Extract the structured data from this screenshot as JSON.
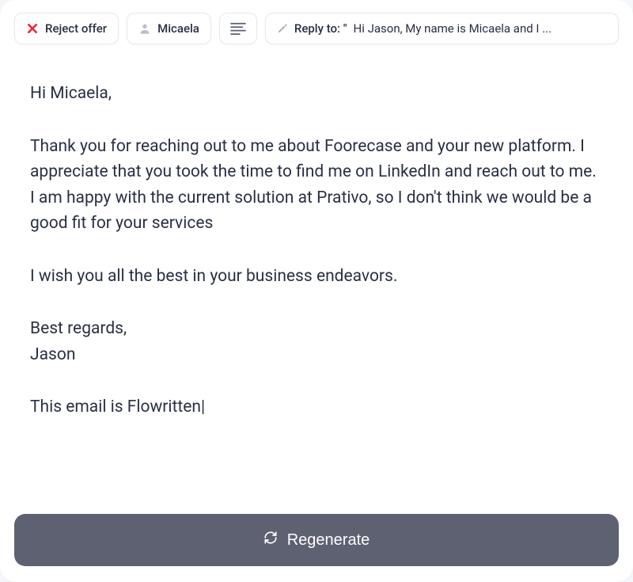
{
  "toolbar": {
    "reject_label": "Reject offer",
    "person_label": "Micaela",
    "reply_prefix": "Reply to: \"",
    "reply_snippet": "Hi Jason, My name is Micaela and I ..."
  },
  "email": {
    "greeting": "Hi Micaela,",
    "para1": "Thank you for reaching out to me about Foorecase and your new platform. I appreciate that you took the time to find me on LinkedIn and reach out to me. I am happy with the current solution at Prativo, so I don't think we would be a good fit for your services",
    "para2": "I wish you all the best in your business endeavors.",
    "signoff": "Best regards,",
    "signer": "Jason",
    "footer": "This email is Flowritten"
  },
  "actions": {
    "regenerate_label": "Regenerate"
  }
}
